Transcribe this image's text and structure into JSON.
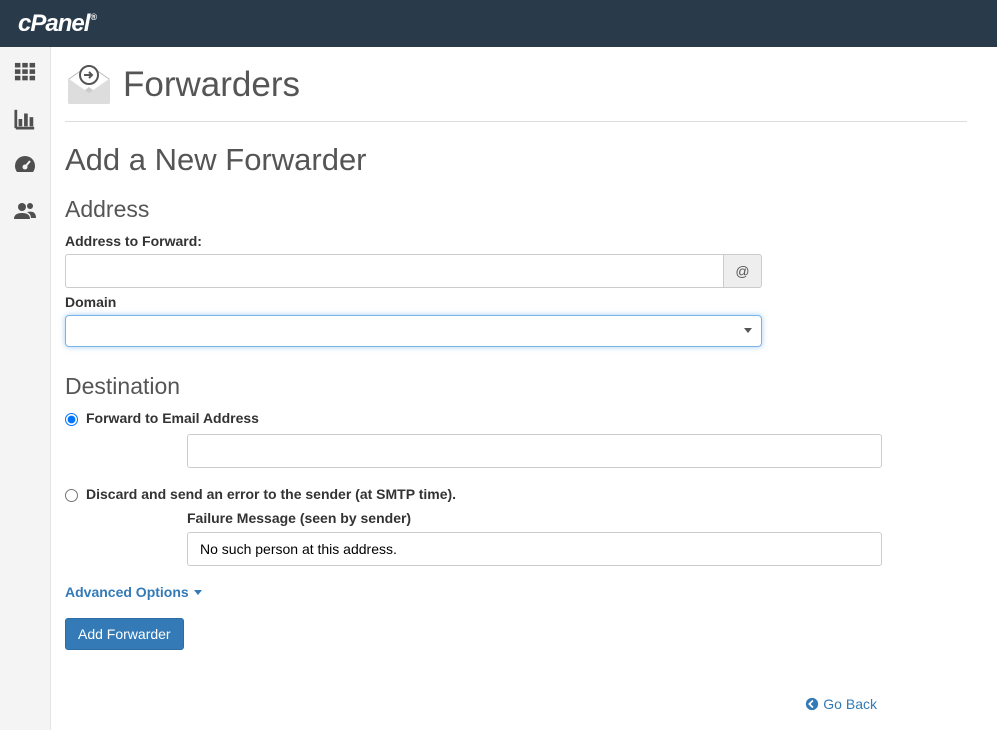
{
  "header": {
    "brand": "cPanel",
    "brand_reg": "®"
  },
  "sidebar": {
    "icon_names": [
      "grid-icon",
      "stats-icon",
      "dashboard-icon",
      "users-icon"
    ]
  },
  "page": {
    "title": "Forwarders",
    "section_title": "Add a New Forwarder"
  },
  "address": {
    "heading": "Address",
    "forward_label": "Address to Forward:",
    "forward_value": "",
    "at_symbol": "@",
    "domain_label": "Domain",
    "domain_value": ""
  },
  "destination": {
    "heading": "Destination",
    "forward_radio_label": "Forward to Email Address",
    "forward_email_value": "",
    "discard_radio_label": "Discard and send an error to the sender (at SMTP time).",
    "failure_label": "Failure Message (seen by sender)",
    "failure_value": "No such person at this address.",
    "selected": "forward"
  },
  "actions": {
    "advanced_label": "Advanced Options",
    "submit_label": "Add Forwarder",
    "go_back_label": "Go Back"
  },
  "colors": {
    "header_bg": "#293a4a",
    "link": "#337ab7",
    "btn_primary_bg": "#337ab7",
    "btn_primary_border": "#2e6da4"
  }
}
